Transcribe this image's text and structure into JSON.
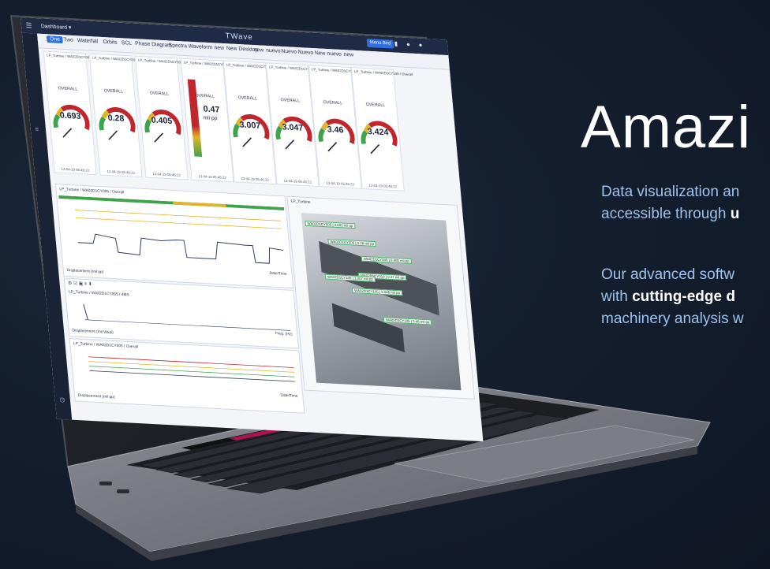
{
  "hero": {
    "title": "Amazi",
    "line1a": "Data visualization an",
    "line1b_pre": "accessible through ",
    "line1b_bold": "u",
    "line2a": "Our advanced softw",
    "line2b_pre": "with ",
    "line2b_bold": "cutting-edge d",
    "line2c": "machinery analysis w"
  },
  "app": {
    "menu_icon": "hamburger-icon",
    "dashboard_label": "Dashboard ▾",
    "brand": "TWave",
    "toolbar_button": "Menu Bird",
    "tabs": [
      "One",
      "Two",
      "Waterfall",
      "Orbits",
      "SCL",
      "Phase Diagram",
      "Spectra",
      "Waveform",
      "new",
      "New Desktop",
      "new",
      "nuevo",
      "Nuevo",
      "Nuevo",
      "New",
      "nuevo",
      "new"
    ]
  },
  "gauges": [
    {
      "title": "LP_Turbine / WA02D1CY005 / Overall",
      "label": "OVERALL",
      "value": "0.693",
      "foot": "13-04-19 05:46:22"
    },
    {
      "title": "LP_Turbine / WA02D1CY005 / Overall",
      "label": "OVERALL",
      "value": "0.28",
      "foot": "13-04-19 05:46:22"
    },
    {
      "title": "LP_Turbine / WA02D1CY005 / Overall",
      "label": "OVERALL",
      "value": "0.405",
      "foot": "13-04-19 05:46:22"
    },
    {
      "title": "LP_Turbine / WA02D1CY010 / Overall",
      "label": "OVERALL",
      "value": "0.47",
      "unit": "mil pp",
      "foot": "13-04-19 05:46:22"
    },
    {
      "title": "LP_Turbine / WA02D1CY105 / Overall",
      "label": "OVERALL",
      "value": "3.007",
      "foot": "13-04-19 05:46:22"
    },
    {
      "title": "LP_Turbine / WA02D1CY105 / Overall",
      "label": "OVERALL",
      "value": "3.047",
      "foot": "13-04-19 05:46:22"
    },
    {
      "title": "LP_Turbine / WA02D1CY105 / Overall",
      "label": "OVERALL",
      "value": "3.46",
      "foot": "13-04-19 05:46:22"
    },
    {
      "title": "LP_Turbine / WA02D1CY105 / Overall",
      "label": "OVERALL",
      "value": "3.424",
      "foot": "13-04-19 05:46:22"
    }
  ],
  "trend": {
    "title": "LP_Turbine / WA02D1CY005 / Overall",
    "ylabel": "Displacement (mil pp)",
    "xlabel": "Date/Time"
  },
  "spectrum": {
    "title": "LP_Turbine / WA02D1CY005 / 4MS",
    "ylabel": "Displacement (mil Wedi)",
    "xlabel": "Freq. (Hz)"
  },
  "trend2": {
    "title": "LP_Turbine / WA02D1CY005 / Overall",
    "ylabel": "Displacement (mil pp)",
    "xlabel": "Date/Time"
  },
  "machine": {
    "title": "LP_Turbine",
    "chips": [
      "WA02D1CY005 | 0.693 mil pp",
      "WA02D1CY005 | 0.28 mil pp",
      "WA02D1CY005 | 0.405 mil pp",
      "WA02D1CY010 | 0.47 mil pp",
      "WA02D1CY105 | 3.007 mil pp",
      "WA02D1CY105 | 3.046 mil pp",
      "WA02D1CY105 | 3.46 mil pp"
    ]
  },
  "colors": {
    "accent": "#2f6fe0",
    "gauge_red": "#c0262d",
    "gauge_yellow": "#e0b52a",
    "gauge_green": "#3fa34d"
  }
}
